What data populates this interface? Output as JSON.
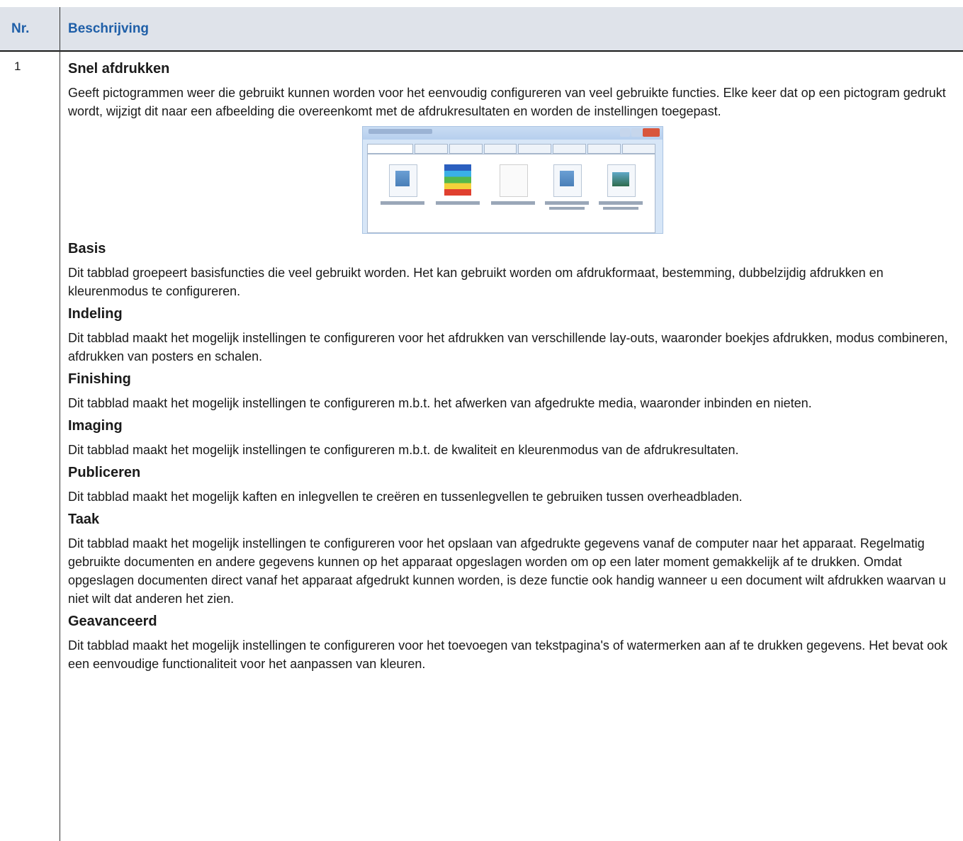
{
  "header": {
    "col_nr": "Nr.",
    "col_desc": "Beschrijving"
  },
  "row": {
    "number": "1",
    "sections": [
      {
        "title": "Snel afdrukken",
        "text": "Geeft pictogrammen weer die gebruikt kunnen worden voor het eenvoudig configureren van veel gebruikte functies. Elke keer dat op een pictogram gedrukt wordt, wijzigt dit naar een afbeelding die overeenkomt met de afdrukresultaten en worden de instellingen toegepast."
      },
      {
        "title": "Basis",
        "text": "Dit tabblad groepeert basisfuncties die veel gebruikt worden. Het kan gebruikt worden om afdrukformaat, bestemming, dubbelzijdig afdrukken en kleurenmodus te configureren."
      },
      {
        "title": "Indeling",
        "text": "Dit tabblad maakt het mogelijk instellingen te configureren voor het afdrukken van verschillende lay-outs, waaronder boekjes afdrukken, modus combineren, afdrukken van posters en schalen."
      },
      {
        "title": "Finishing",
        "text": "Dit tabblad maakt het mogelijk instellingen te configureren m.b.t. het afwerken van afgedrukte media, waaronder inbinden en nieten."
      },
      {
        "title": "Imaging",
        "text": "Dit tabblad maakt het mogelijk instellingen te configureren m.b.t. de kwaliteit en kleurenmodus van de afdrukresultaten."
      },
      {
        "title": "Publiceren",
        "text": "Dit tabblad maakt het mogelijk kaften en inlegvellen te creëren en tussenlegvellen te gebruiken tussen overheadbladen."
      },
      {
        "title": "Taak",
        "text": "Dit tabblad maakt het mogelijk instellingen te configureren voor het opslaan van afgedrukte gegevens vanaf de computer naar het apparaat. Regelmatig gebruikte documenten en andere gegevens kunnen op het apparaat opgeslagen worden om op een later moment gemakkelijk af te drukken. Omdat opgeslagen documenten direct vanaf het apparaat afgedrukt kunnen worden, is deze functie ook handig wanneer u een document wilt afdrukken waarvan u niet wilt dat anderen het zien."
      },
      {
        "title": "Geavanceerd",
        "text": "Dit tabblad maakt het mogelijk instellingen te configureren voor het toevoegen van tekstpagina's of watermerken aan af te drukken gegevens. Het  bevat ook een eenvoudige functionaliteit voor het aanpassen van kleuren."
      }
    ]
  }
}
